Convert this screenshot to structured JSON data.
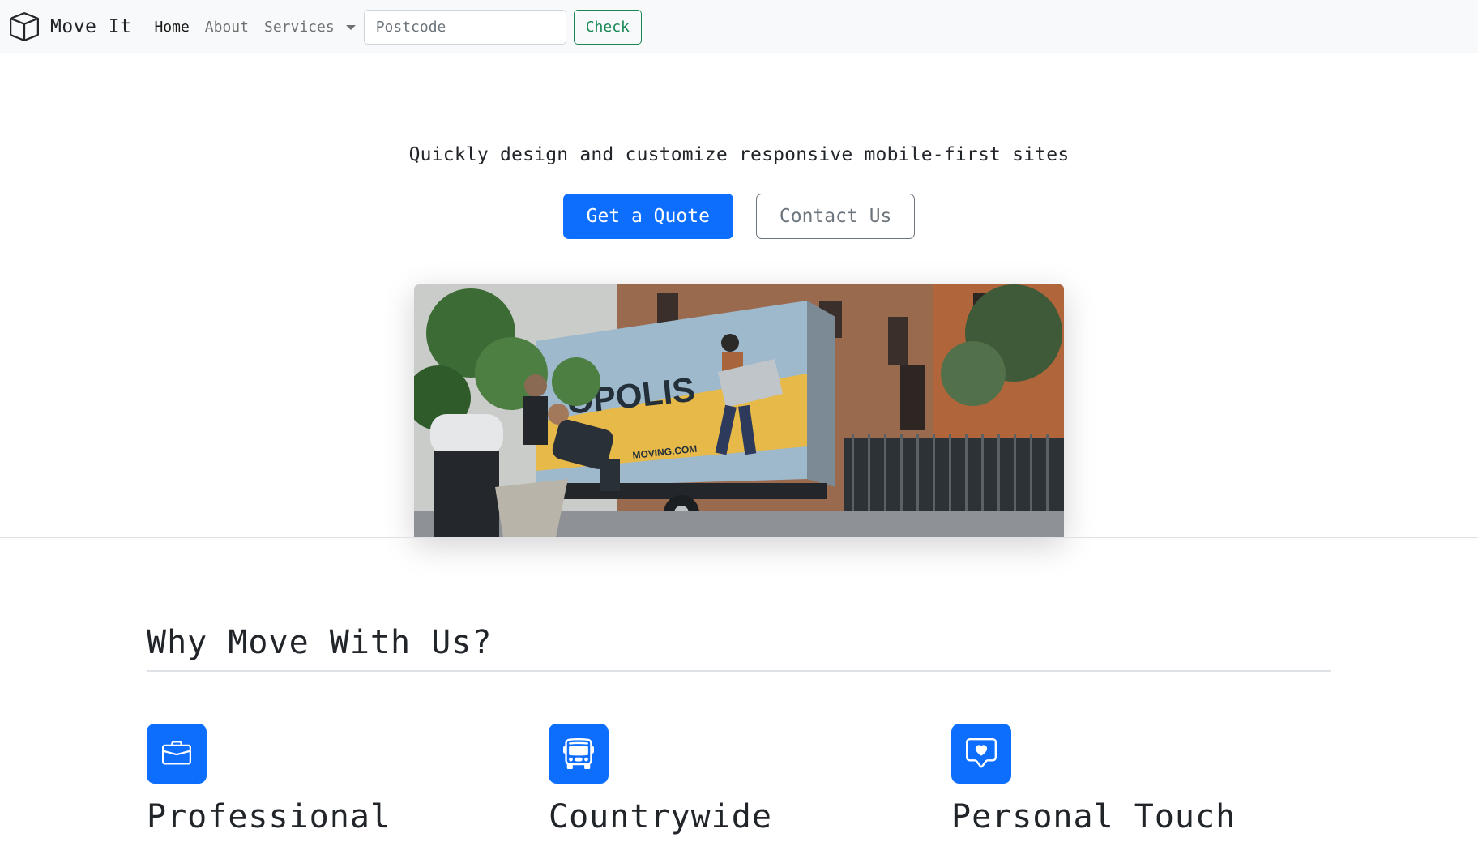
{
  "brand": {
    "name": "Move It",
    "icon": "box-icon"
  },
  "nav": {
    "home": "Home",
    "about": "About",
    "services": "Services"
  },
  "search": {
    "placeholder": "Postcode",
    "button": "Check"
  },
  "hero": {
    "lead": "Quickly design and customize responsive mobile-first sites",
    "primary_button": "Get a Quote",
    "secondary_button": "Contact Us",
    "image_truck_text": "OPOLIS",
    "image_truck_web": "MOVING.COM"
  },
  "features": {
    "title": "Why Move With Us?",
    "items": [
      {
        "icon": "briefcase-icon",
        "title": "Professional"
      },
      {
        "icon": "bus-icon",
        "title": "Countrywide"
      },
      {
        "icon": "chat-heart-icon",
        "title": "Personal Touch"
      }
    ]
  },
  "colors": {
    "primary": "#0d6efd",
    "success": "#198754",
    "secondary": "#6c757d",
    "navbar_bg": "#f8f9fa"
  }
}
